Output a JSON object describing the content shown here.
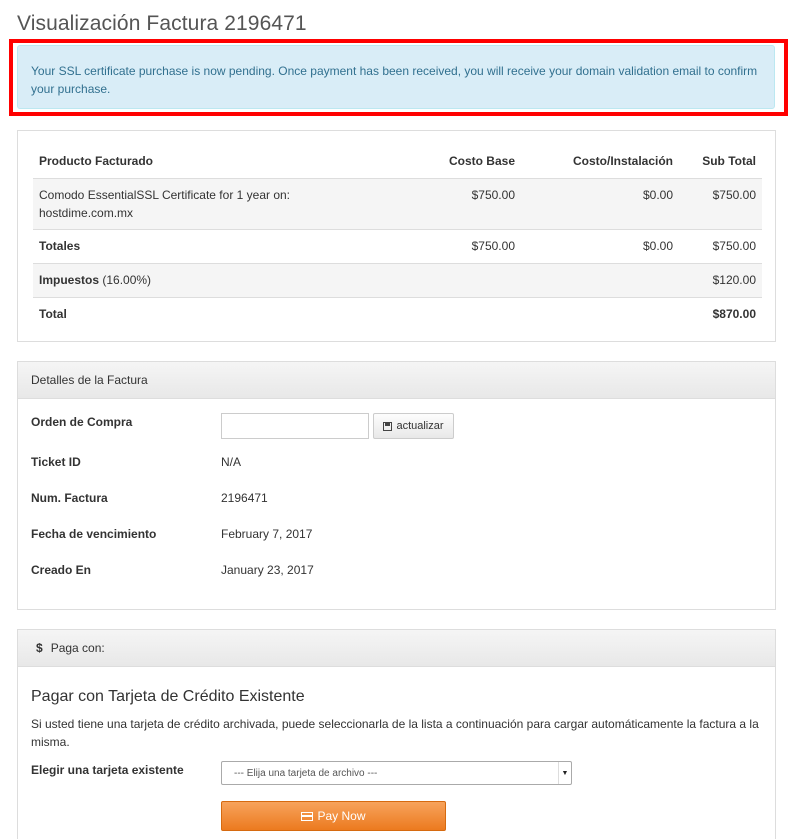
{
  "page": {
    "title": "Visualización Factura 2196471"
  },
  "alert": {
    "message": "Your SSL certificate purchase is now pending. Once payment has been received, you will receive your domain validation email to confirm your purchase."
  },
  "invoice": {
    "headers": {
      "product": "Producto Facturado",
      "base_cost": "Costo Base",
      "setup_cost": "Costo/Instalación",
      "subtotal": "Sub Total"
    },
    "item": {
      "description": "Comodo EssentialSSL Certificate for 1 year on: hostdime.com.mx",
      "base_cost": "$750.00",
      "setup_cost": "$0.00",
      "subtotal": "$750.00"
    },
    "totals": {
      "label": "Totales",
      "base_cost": "$750.00",
      "setup_cost": "$0.00",
      "subtotal": "$750.00"
    },
    "taxes": {
      "label": "Impuestos",
      "rate": "(16.00%)",
      "amount": "$120.00"
    },
    "total": {
      "label": "Total",
      "amount": "$870.00"
    }
  },
  "details": {
    "heading": "Detalles de la Factura",
    "purchase_order_label": "Orden de Compra",
    "purchase_order_value": "",
    "update_button": "actualizar",
    "ticket_label": "Ticket ID",
    "ticket_value": "N/A",
    "invoice_num_label": "Num. Factura",
    "invoice_num_value": "2196471",
    "due_date_label": "Fecha de vencimiento",
    "due_date_value": "February 7, 2017",
    "created_label": "Creado En",
    "created_value": "January 23, 2017"
  },
  "payment": {
    "heading_icon": "$",
    "heading": "Paga con:",
    "title": "Pagar con Tarjeta de Crédito Existente",
    "description": "Si usted tiene una tarjeta de crédito archivada, puede seleccionarla de la lista a continuación para cargar automáticamente la factura a la misma.",
    "card_label": "Elegir una tarjeta existente",
    "card_select_value": "--- Elija una tarjeta de archivo ---",
    "pay_button": "Pay Now"
  },
  "colors": {
    "alert_bg": "#d9edf7",
    "alert_text": "#31708f",
    "highlight": "#ff0000",
    "pay_button": "#ec7a1f"
  },
  "icons": {
    "update": "save-icon",
    "pay": "credit-card-icon",
    "heading": "dollar-icon",
    "select": "caret-down-icon"
  }
}
